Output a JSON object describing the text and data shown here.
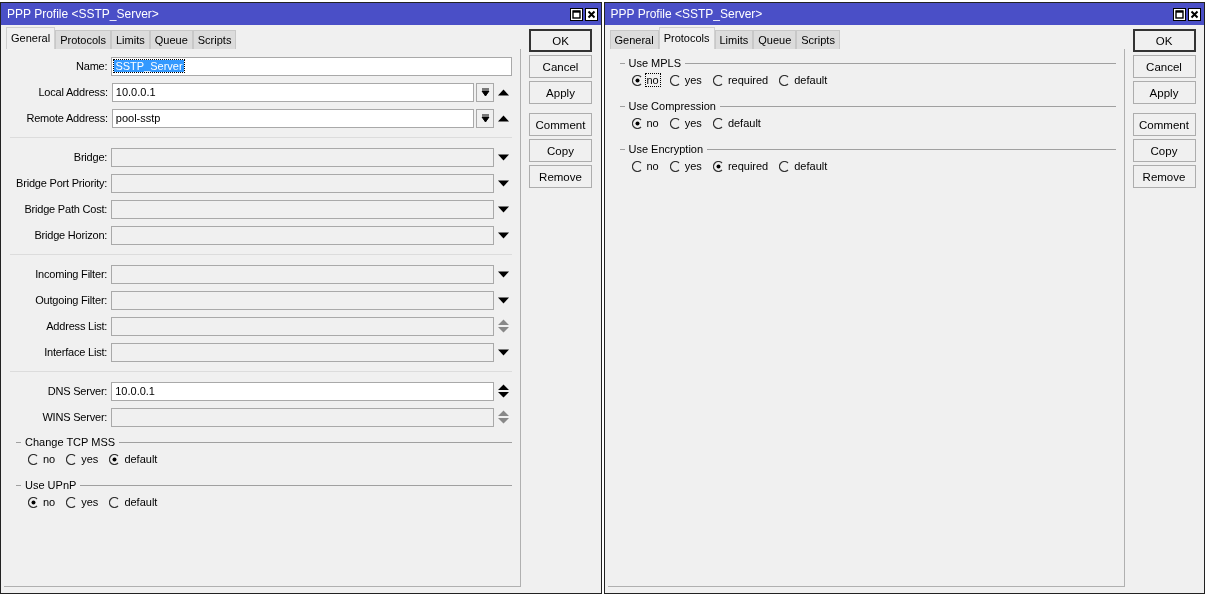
{
  "windows": [
    {
      "title": "PPP Profile <SSTP_Server>",
      "tabs": [
        {
          "label": "General",
          "selected": true
        },
        {
          "label": "Protocols",
          "selected": false
        },
        {
          "label": "Limits",
          "selected": false
        },
        {
          "label": "Queue",
          "selected": false
        },
        {
          "label": "Scripts",
          "selected": false
        }
      ],
      "sections": [
        {
          "kind": "fields",
          "rows": [
            {
              "label": "Name:",
              "value": "SSTP_Server",
              "disabled": false,
              "highlighted": true,
              "kind": "none"
            },
            {
              "label": "Local Address:",
              "value": "10.0.0.1",
              "disabled": false,
              "highlighted": false,
              "kind": "combo-add"
            },
            {
              "label": "Remote Address:",
              "value": "pool-sstp",
              "disabled": false,
              "highlighted": false,
              "kind": "combo-add"
            }
          ]
        },
        {
          "kind": "fields",
          "rows": [
            {
              "label": "Bridge:",
              "disabled": true,
              "kind": "dropdown"
            },
            {
              "label": "Bridge Port Priority:",
              "disabled": true,
              "kind": "dropdown"
            },
            {
              "label": "Bridge Path Cost:",
              "disabled": true,
              "kind": "dropdown"
            },
            {
              "label": "Bridge Horizon:",
              "disabled": true,
              "kind": "dropdown"
            }
          ]
        },
        {
          "kind": "fields",
          "rows": [
            {
              "label": "Incoming Filter:",
              "disabled": true,
              "kind": "dropdown"
            },
            {
              "label": "Outgoing Filter:",
              "disabled": true,
              "kind": "dropdown"
            },
            {
              "label": "Address List:",
              "disabled": true,
              "kind": "spinner"
            },
            {
              "label": "Interface List:",
              "disabled": true,
              "kind": "dropdown"
            }
          ]
        },
        {
          "kind": "fields",
          "rows": [
            {
              "label": "DNS Server:",
              "value": "10.0.0.1",
              "disabled": false,
              "highlighted": false,
              "kind": "spinner"
            },
            {
              "label": "WINS Server:",
              "disabled": true,
              "kind": "spinner"
            }
          ]
        },
        {
          "kind": "radio",
          "title": "Change TCP MSS",
          "options": [
            {
              "label": "no",
              "selected": false,
              "focused": false
            },
            {
              "label": "yes",
              "selected": false,
              "focused": false
            },
            {
              "label": "default",
              "selected": true,
              "focused": false
            }
          ]
        },
        {
          "kind": "radio",
          "title": "Use UPnP",
          "options": [
            {
              "label": "no",
              "selected": true,
              "focused": false
            },
            {
              "label": "yes",
              "selected": false,
              "focused": false
            },
            {
              "label": "default",
              "selected": false,
              "focused": false
            }
          ]
        }
      ],
      "button_groups": [
        [
          {
            "label": "OK",
            "default": true
          },
          {
            "label": "Cancel",
            "default": false
          },
          {
            "label": "Apply",
            "default": false
          }
        ],
        [
          {
            "label": "Comment",
            "default": false
          },
          {
            "label": "Copy",
            "default": false
          },
          {
            "label": "Remove",
            "default": false
          }
        ]
      ]
    },
    {
      "title": "PPP Profile <SSTP_Server>",
      "tabs": [
        {
          "label": "General",
          "selected": false
        },
        {
          "label": "Protocols",
          "selected": true
        },
        {
          "label": "Limits",
          "selected": false
        },
        {
          "label": "Queue",
          "selected": false
        },
        {
          "label": "Scripts",
          "selected": false
        }
      ],
      "sections": [
        {
          "kind": "radio",
          "title": "Use MPLS",
          "options": [
            {
              "label": "no",
              "selected": true,
              "focused": true
            },
            {
              "label": "yes",
              "selected": false,
              "focused": false
            },
            {
              "label": "required",
              "selected": false,
              "focused": false
            },
            {
              "label": "default",
              "selected": false,
              "focused": false
            }
          ]
        },
        {
          "kind": "radio",
          "title": "Use Compression",
          "options": [
            {
              "label": "no",
              "selected": true,
              "focused": false
            },
            {
              "label": "yes",
              "selected": false,
              "focused": false
            },
            {
              "label": "default",
              "selected": false,
              "focused": false
            }
          ]
        },
        {
          "kind": "radio",
          "title": "Use Encryption",
          "options": [
            {
              "label": "no",
              "selected": false,
              "focused": false
            },
            {
              "label": "yes",
              "selected": false,
              "focused": false
            },
            {
              "label": "required",
              "selected": true,
              "focused": false
            },
            {
              "label": "default",
              "selected": false,
              "focused": false
            }
          ]
        }
      ],
      "button_groups": [
        [
          {
            "label": "OK",
            "default": true
          },
          {
            "label": "Cancel",
            "default": false
          },
          {
            "label": "Apply",
            "default": false
          }
        ],
        [
          {
            "label": "Comment",
            "default": false
          },
          {
            "label": "Copy",
            "default": false
          },
          {
            "label": "Remove",
            "default": false
          }
        ]
      ]
    }
  ]
}
